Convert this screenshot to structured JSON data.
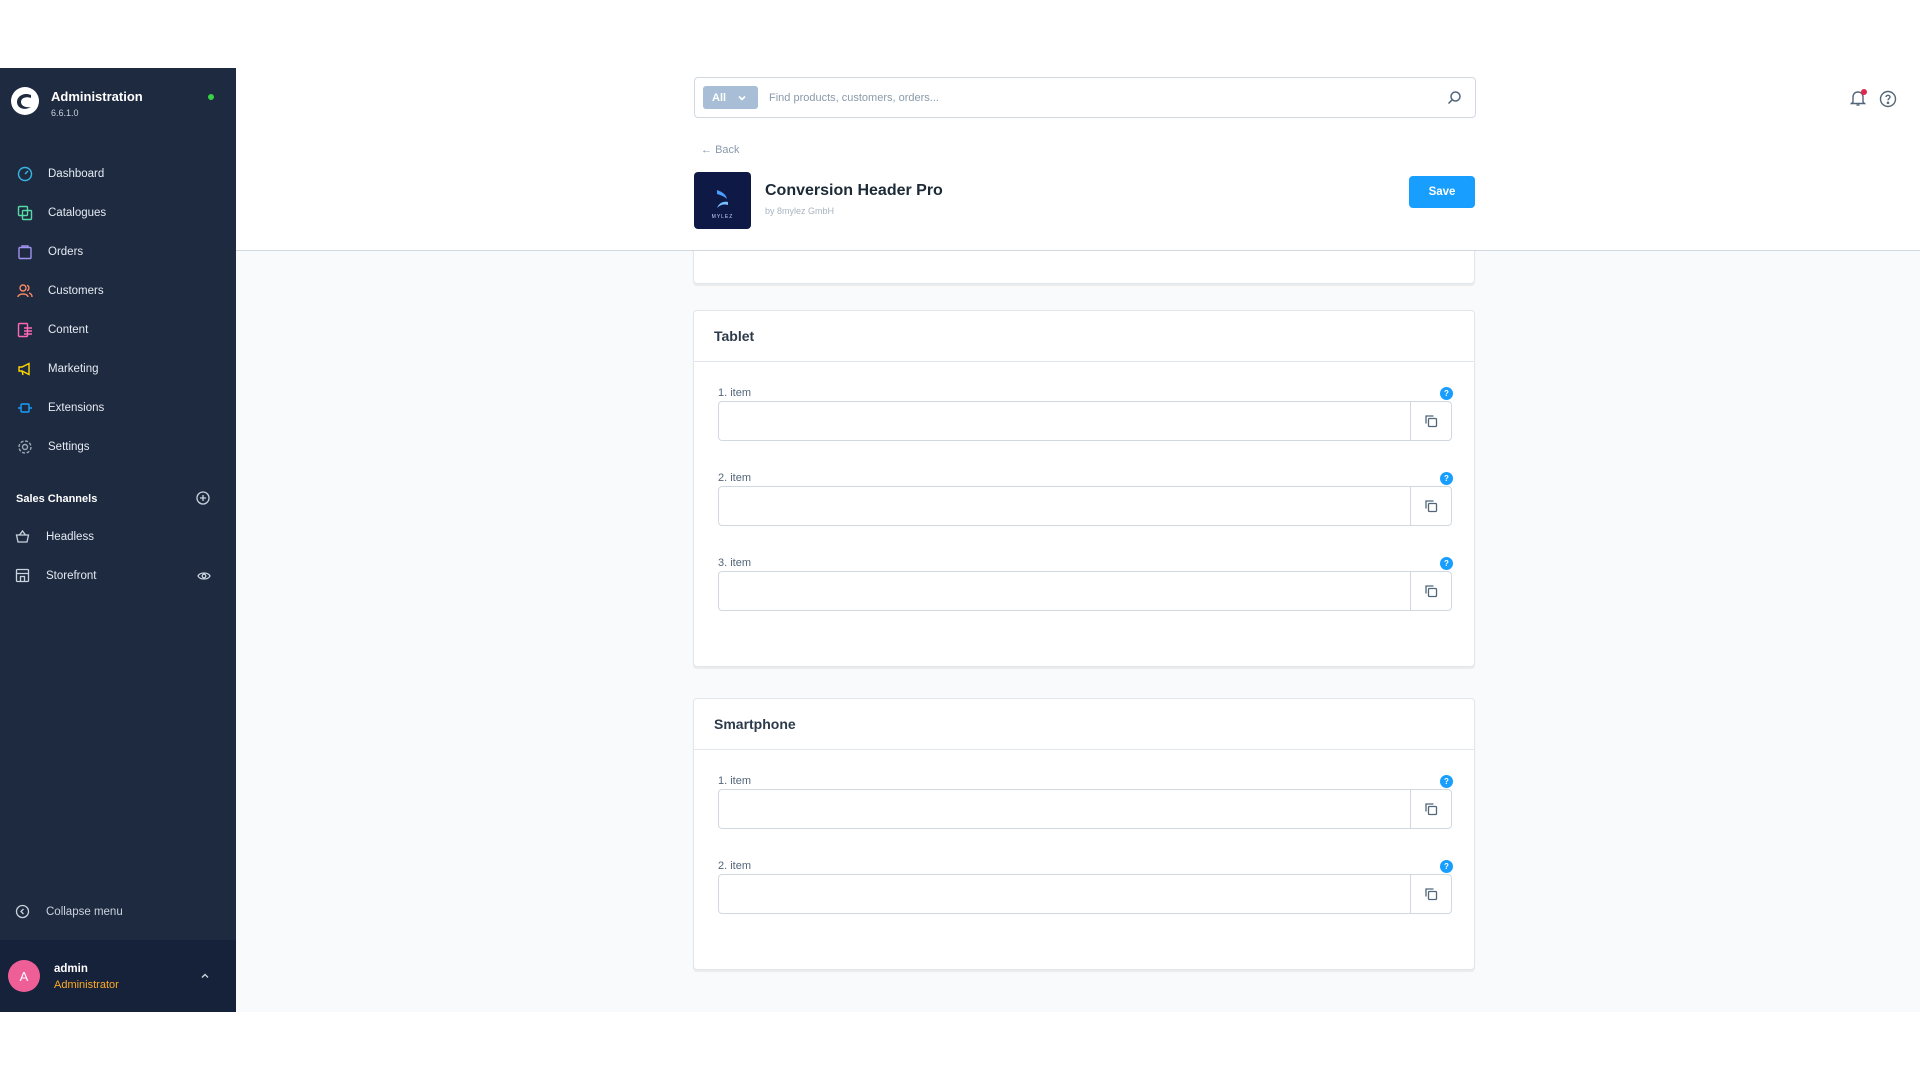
{
  "sidebar": {
    "brand_title": "Administration",
    "version": "6.6.1.0",
    "nav": [
      {
        "label": "Dashboard",
        "icon": "dashboard-icon",
        "color": "#38b7e6"
      },
      {
        "label": "Catalogues",
        "icon": "catalogues-icon",
        "color": "#57d9a3"
      },
      {
        "label": "Orders",
        "icon": "orders-icon",
        "color": "#a092f0"
      },
      {
        "label": "Customers",
        "icon": "customers-icon",
        "color": "#f88962"
      },
      {
        "label": "Content",
        "icon": "content-icon",
        "color": "#ff68b4"
      },
      {
        "label": "Marketing",
        "icon": "marketing-icon",
        "color": "#ffd700"
      },
      {
        "label": "Extensions",
        "icon": "extensions-icon",
        "color": "#189eff"
      },
      {
        "label": "Settings",
        "icon": "settings-icon",
        "color": "#9aa8b5"
      }
    ],
    "sales_channels_heading": "Sales Channels",
    "sales_channels": [
      {
        "label": "Headless",
        "icon": "basket-icon"
      },
      {
        "label": "Storefront",
        "icon": "storefront-icon"
      }
    ],
    "collapse_label": "Collapse menu",
    "user": {
      "initial": "A",
      "name": "admin",
      "role": "Administrator"
    }
  },
  "header": {
    "search_scope": "All",
    "search_placeholder": "Find products, customers, orders...",
    "back_label": "Back",
    "plugin_title": "Conversion Header Pro",
    "plugin_vendor": "by 8mylez GmbH",
    "plugin_logo_text": "MYLEZ",
    "save_label": "Save"
  },
  "cards": {
    "tablet": {
      "title": "Tablet",
      "fields": [
        {
          "label": "1. item",
          "value": ""
        },
        {
          "label": "2. item",
          "value": ""
        },
        {
          "label": "3. item",
          "value": ""
        }
      ]
    },
    "smartphone": {
      "title": "Smartphone",
      "fields": [
        {
          "label": "1. item",
          "value": ""
        },
        {
          "label": "2. item",
          "value": ""
        }
      ]
    }
  },
  "colors": {
    "accent": "#189eff",
    "sidebar_bg": "#1e2a40",
    "status_online": "#37d046",
    "user_role": "#ffab22"
  }
}
